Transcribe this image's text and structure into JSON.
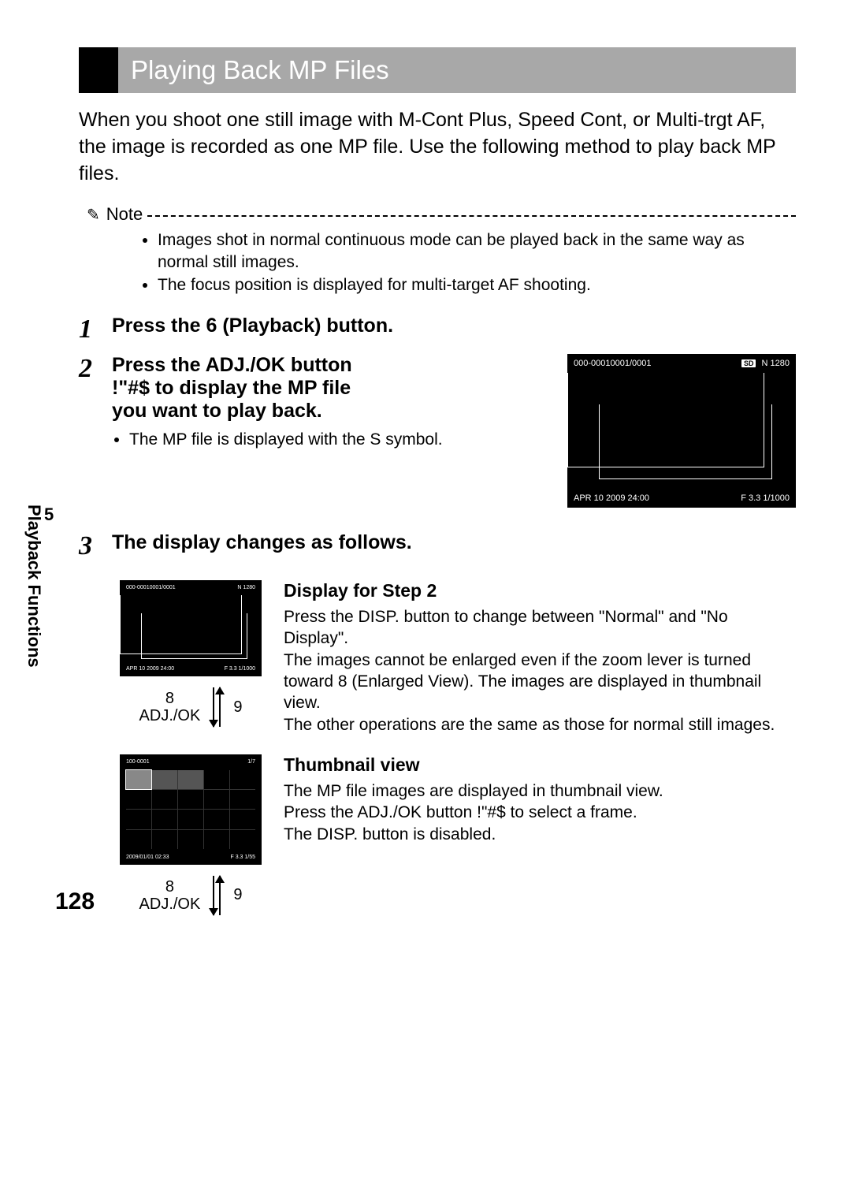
{
  "title": "Playing Back MP Files",
  "intro": "When you shoot one still image with M-Cont Plus, Speed Cont, or Multi-trgt AF, the image is recorded as one MP file. Use the following method to play back MP files.",
  "note": {
    "label": "Note",
    "items": [
      "Images shot in normal continuous mode can be played back in the same way as normal still images.",
      "The focus position is displayed for multi-target AF shooting."
    ]
  },
  "steps": {
    "s1": {
      "num": "1",
      "text": "Press the 6 (Playback) button."
    },
    "s2": {
      "num": "2",
      "line1": "Press the ADJ./OK button",
      "line2": "!\"#$ to display the MP file",
      "line3": "you want to play back.",
      "bullet": "The MP file is displayed with the S symbol."
    },
    "s3": {
      "num": "3",
      "text": "The display changes as follows."
    }
  },
  "screen_large": {
    "tl1": "000-0001",
    "tl2": "0001/0001",
    "tr_sd": "SD",
    "tr": "N 1280",
    "bl": "APR 10 2009 24:00",
    "br": "F 3.3 1/1000"
  },
  "screen_small": {
    "tl1": "000-0001",
    "tl2": "0001/0001",
    "tr": "N 1280",
    "bl": "APR 10 2009 24:00",
    "br": "F 3.3 1/1000"
  },
  "screen_thumb": {
    "tl1": "100-0001",
    "tl2": "1/7",
    "bl": "2009/01/01 02:33",
    "br": "F 3.3 1/55"
  },
  "adj": {
    "left_top": "8",
    "left_bottom": "ADJ./OK",
    "right": "9"
  },
  "display_step2": {
    "heading": "Display for Step 2",
    "p1": "Press the DISP. button to change between \"Normal\" and \"No Display\".",
    "p2": "The images cannot be enlarged even if the zoom lever is turned toward 8 (Enlarged View). The images are displayed in thumbnail view.",
    "p3": "The other operations are the same as those for normal still images."
  },
  "thumbnail_view": {
    "heading": "Thumbnail view",
    "p1": "The MP file images are displayed in thumbnail view.",
    "p2": "Press the ADJ./OK button !\"#$ to select a frame.",
    "p3": "The DISP. button is disabled."
  },
  "side": {
    "chapter": "5",
    "label": "Playback Functions"
  },
  "page_number": "128"
}
